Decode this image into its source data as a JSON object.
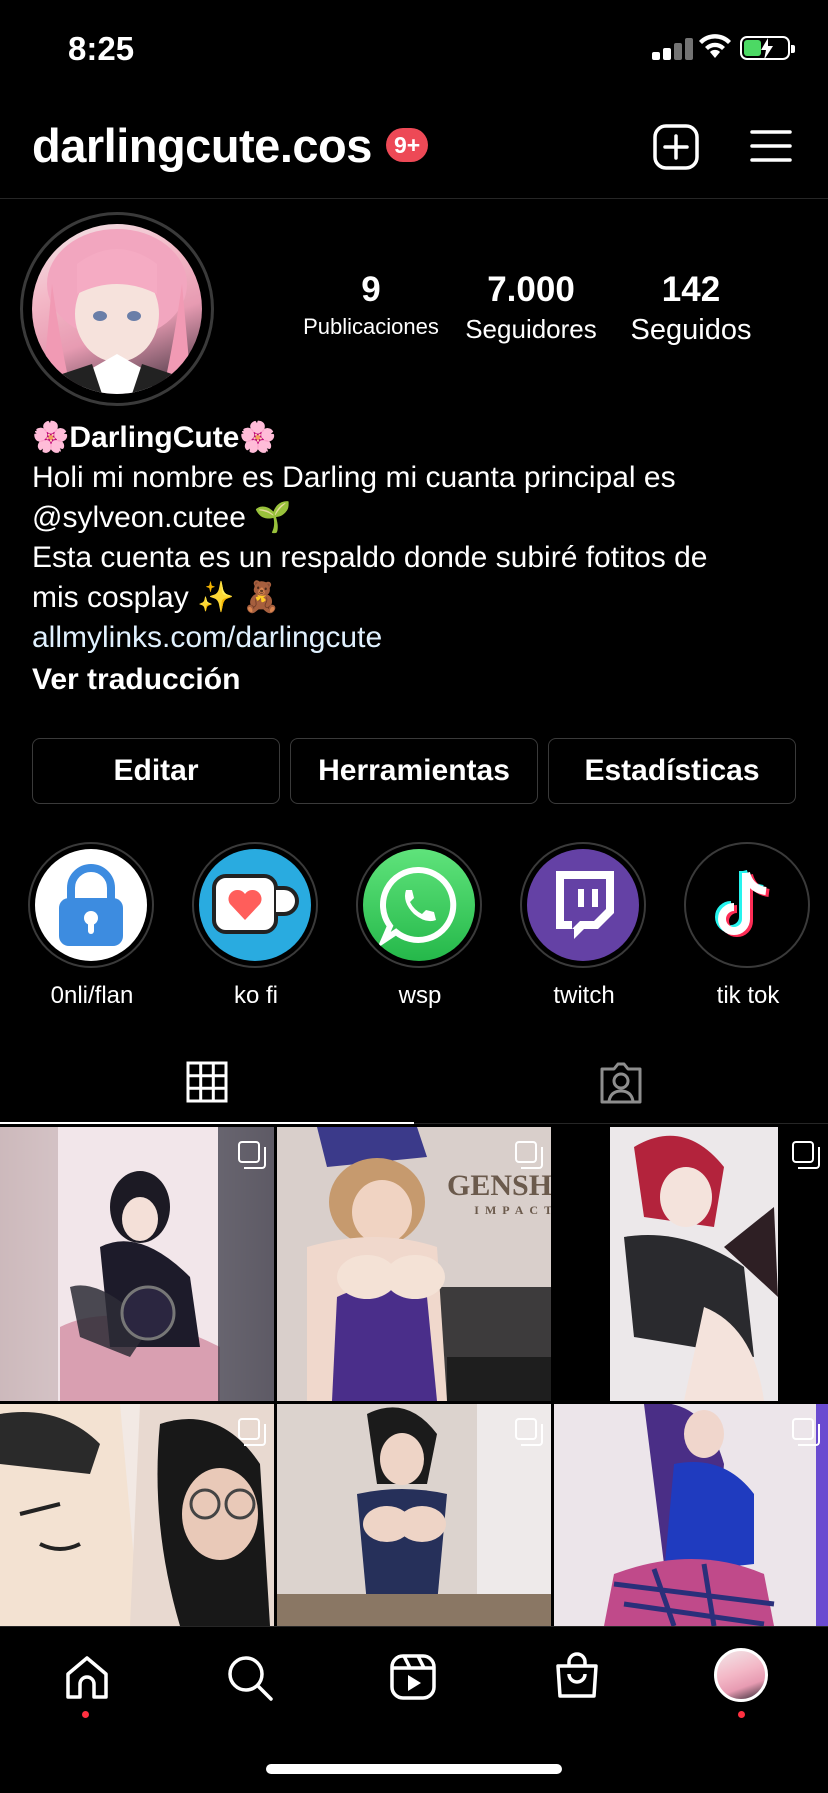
{
  "status_bar": {
    "time": "8:25"
  },
  "header": {
    "username": "darlingcute.cos",
    "notification_badge": "9+",
    "badge_color": "#ed4956"
  },
  "profile": {
    "stats": [
      {
        "number": "9",
        "label": "Publicaciones"
      },
      {
        "number": "7.000",
        "label": "Seguidores"
      },
      {
        "number": "142",
        "label": "Seguidos"
      }
    ]
  },
  "bio": {
    "name": "🌸DarlingCute🌸",
    "line1": "Holi mi nombre es Darling mi cuanta principal es",
    "line2": "@sylveon.cutee 🌱",
    "line3": "Esta cuenta es un respaldo donde subiré fotitos de",
    "line4": "mis cosplay ✨ 🧸",
    "link": "allmylinks.com/darlingcute",
    "translate": "Ver traducción"
  },
  "action_buttons": {
    "edit": "Editar",
    "tools": "Herramientas",
    "stats": "Estadísticas"
  },
  "highlights": [
    {
      "label": "0nli/flan",
      "icon": "lock-icon"
    },
    {
      "label": "ko fi",
      "icon": "kofi-cup-icon"
    },
    {
      "label": "wsp",
      "icon": "whatsapp-icon"
    },
    {
      "label": "twitch",
      "icon": "twitch-icon"
    },
    {
      "label": "tik tok",
      "icon": "tiktok-icon"
    }
  ],
  "tabs": [
    {
      "name": "posts-grid",
      "icon": "grid-icon",
      "active": true
    },
    {
      "name": "tagged",
      "icon": "tagged-person-icon",
      "active": false
    }
  ],
  "grid_overlay_text": {
    "tile2_watermark": "GENSHIN",
    "tile2_watermark_sub": "IMPACT"
  },
  "bottom_nav": [
    {
      "name": "home",
      "icon": "home-icon"
    },
    {
      "name": "search",
      "icon": "search-icon"
    },
    {
      "name": "reels",
      "icon": "reels-icon"
    },
    {
      "name": "shop",
      "icon": "shopping-bag-icon"
    },
    {
      "name": "profile",
      "icon": "profile-avatar-icon"
    }
  ],
  "colors": {
    "background": "#000000",
    "divider": "#262626",
    "notification_dot": "#ff3040",
    "link": "#e0f1ff",
    "whatsapp": "#25d366",
    "twitch": "#6441a5",
    "kofi": "#29abe0"
  }
}
